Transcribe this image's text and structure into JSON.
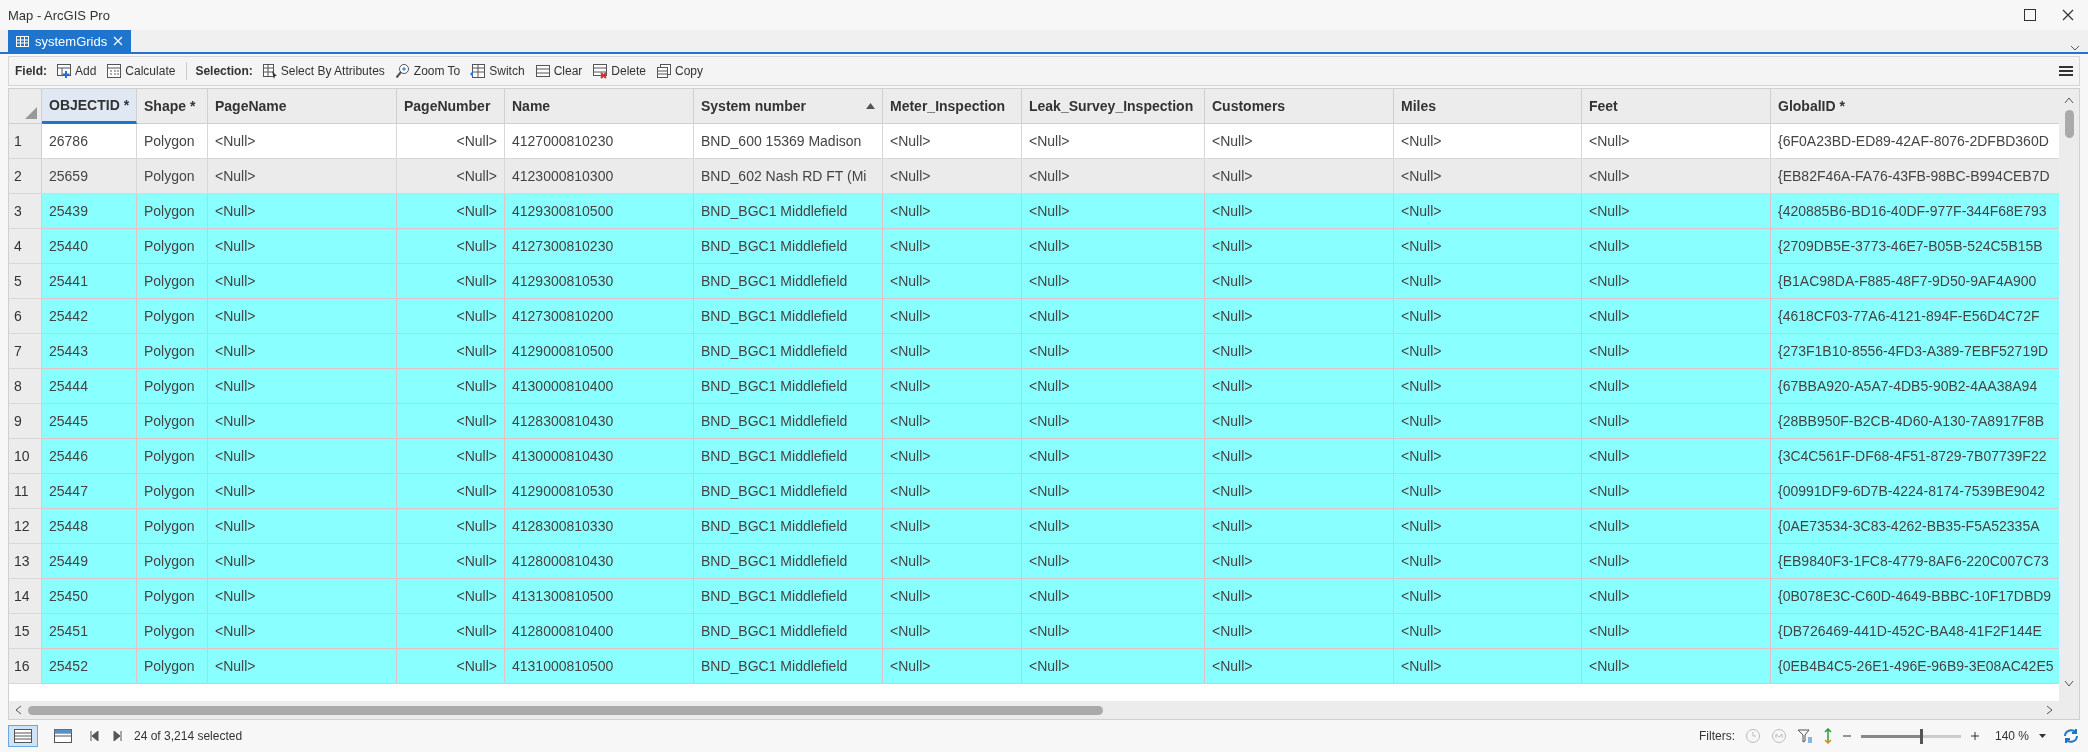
{
  "window": {
    "title": "Map - ArcGIS Pro"
  },
  "tabs": [
    {
      "label": "systemGrids",
      "selected": true
    }
  ],
  "toolbar": {
    "groups": [
      {
        "label": "Field:",
        "buttons": [
          {
            "label": "Add",
            "kind": "add"
          },
          {
            "label": "Calculate",
            "kind": "calculate"
          }
        ]
      },
      {
        "label": "Selection:",
        "buttons": [
          {
            "label": "Select By Attributes",
            "kind": "select"
          },
          {
            "label": "Zoom To",
            "kind": "zoom"
          },
          {
            "label": "Switch",
            "kind": "switch"
          },
          {
            "label": "Clear",
            "kind": "clear"
          },
          {
            "label": "Delete",
            "kind": "delete"
          },
          {
            "label": "Copy",
            "kind": "copy"
          }
        ]
      }
    ]
  },
  "table": {
    "columns": [
      {
        "label": "OBJECTID *",
        "kind": "text",
        "sorted": false,
        "focused": true
      },
      {
        "label": "Shape *",
        "kind": "text",
        "sorted": false,
        "focused": false
      },
      {
        "label": "PageName",
        "kind": "text",
        "sorted": false,
        "focused": false
      },
      {
        "label": "PageNumber",
        "kind": "numeric",
        "sorted": false,
        "focused": false
      },
      {
        "label": "Name",
        "kind": "text",
        "sorted": false,
        "focused": false
      },
      {
        "label": "System number",
        "kind": "text",
        "sorted": true,
        "focused": false
      },
      {
        "label": "Meter_Inspection",
        "kind": "text",
        "sorted": false,
        "focused": false
      },
      {
        "label": "Leak_Survey_Inspection",
        "kind": "text",
        "sorted": false,
        "focused": false
      },
      {
        "label": "Customers",
        "kind": "text",
        "sorted": false,
        "focused": false
      },
      {
        "label": "Miles",
        "kind": "text",
        "sorted": false,
        "focused": false
      },
      {
        "label": "Feet",
        "kind": "text",
        "sorted": false,
        "focused": false
      },
      {
        "label": "GlobalID *",
        "kind": "text",
        "sorted": false,
        "focused": false
      }
    ],
    "rows": [
      {
        "number": "1",
        "selected": false,
        "cells": [
          "26786",
          "Polygon",
          "<Null>",
          "<Null>",
          "4127000810230",
          "BND_600 15369 Madison",
          "<Null>",
          "<Null>",
          "<Null>",
          "<Null>",
          "<Null>",
          "{6F0A23BD-ED89-42AF-8076-2DFBD360D"
        ]
      },
      {
        "number": "2",
        "selected": false,
        "cells": [
          "25659",
          "Polygon",
          "<Null>",
          "<Null>",
          "4123000810300",
          "BND_602 Nash RD FT (Mi",
          "<Null>",
          "<Null>",
          "<Null>",
          "<Null>",
          "<Null>",
          "{EB82F46A-FA76-43FB-98BC-B994CEB7D"
        ]
      },
      {
        "number": "3",
        "selected": true,
        "cells": [
          "25439",
          "Polygon",
          "<Null>",
          "<Null>",
          "4129300810500",
          "BND_BGC1 Middlefield",
          "<Null>",
          "<Null>",
          "<Null>",
          "<Null>",
          "<Null>",
          "{420885B6-BD16-40DF-977F-344F68E793"
        ]
      },
      {
        "number": "4",
        "selected": true,
        "cells": [
          "25440",
          "Polygon",
          "<Null>",
          "<Null>",
          "4127300810230",
          "BND_BGC1 Middlefield",
          "<Null>",
          "<Null>",
          "<Null>",
          "<Null>",
          "<Null>",
          "{2709DB5E-3773-46E7-B05B-524C5B15B"
        ]
      },
      {
        "number": "5",
        "selected": true,
        "cells": [
          "25441",
          "Polygon",
          "<Null>",
          "<Null>",
          "4129300810530",
          "BND_BGC1 Middlefield",
          "<Null>",
          "<Null>",
          "<Null>",
          "<Null>",
          "<Null>",
          "{B1AC98DA-F885-48F7-9D50-9AF4A900"
        ]
      },
      {
        "number": "6",
        "selected": true,
        "cells": [
          "25442",
          "Polygon",
          "<Null>",
          "<Null>",
          "4127300810200",
          "BND_BGC1 Middlefield",
          "<Null>",
          "<Null>",
          "<Null>",
          "<Null>",
          "<Null>",
          "{4618CF03-77A6-4121-894F-E56D4C72F"
        ]
      },
      {
        "number": "7",
        "selected": true,
        "cells": [
          "25443",
          "Polygon",
          "<Null>",
          "<Null>",
          "4129000810500",
          "BND_BGC1 Middlefield",
          "<Null>",
          "<Null>",
          "<Null>",
          "<Null>",
          "<Null>",
          "{273F1B10-8556-4FD3-A389-7EBF52719D"
        ]
      },
      {
        "number": "8",
        "selected": true,
        "cells": [
          "25444",
          "Polygon",
          "<Null>",
          "<Null>",
          "4130000810400",
          "BND_BGC1 Middlefield",
          "<Null>",
          "<Null>",
          "<Null>",
          "<Null>",
          "<Null>",
          "{67BBA920-A5A7-4DB5-90B2-4AA38A94"
        ]
      },
      {
        "number": "9",
        "selected": true,
        "cells": [
          "25445",
          "Polygon",
          "<Null>",
          "<Null>",
          "4128300810430",
          "BND_BGC1 Middlefield",
          "<Null>",
          "<Null>",
          "<Null>",
          "<Null>",
          "<Null>",
          "{28BB950F-B2CB-4D60-A130-7A8917F8B"
        ]
      },
      {
        "number": "10",
        "selected": true,
        "cells": [
          "25446",
          "Polygon",
          "<Null>",
          "<Null>",
          "4130000810430",
          "BND_BGC1 Middlefield",
          "<Null>",
          "<Null>",
          "<Null>",
          "<Null>",
          "<Null>",
          "{3C4C561F-DF68-4F51-8729-7B07739F22"
        ]
      },
      {
        "number": "11",
        "selected": true,
        "cells": [
          "25447",
          "Polygon",
          "<Null>",
          "<Null>",
          "4129000810530",
          "BND_BGC1 Middlefield",
          "<Null>",
          "<Null>",
          "<Null>",
          "<Null>",
          "<Null>",
          "{00991DF9-6D7B-4224-8174-7539BE9042"
        ]
      },
      {
        "number": "12",
        "selected": true,
        "cells": [
          "25448",
          "Polygon",
          "<Null>",
          "<Null>",
          "4128300810330",
          "BND_BGC1 Middlefield",
          "<Null>",
          "<Null>",
          "<Null>",
          "<Null>",
          "<Null>",
          "{0AE73534-3C83-4262-BB35-F5A52335A"
        ]
      },
      {
        "number": "13",
        "selected": true,
        "cells": [
          "25449",
          "Polygon",
          "<Null>",
          "<Null>",
          "4128000810430",
          "BND_BGC1 Middlefield",
          "<Null>",
          "<Null>",
          "<Null>",
          "<Null>",
          "<Null>",
          "{EB9840F3-1FC8-4779-8AF6-220C007C73"
        ]
      },
      {
        "number": "14",
        "selected": true,
        "cells": [
          "25450",
          "Polygon",
          "<Null>",
          "<Null>",
          "4131300810500",
          "BND_BGC1 Middlefield",
          "<Null>",
          "<Null>",
          "<Null>",
          "<Null>",
          "<Null>",
          "{0B078E3C-C60D-4649-BBBC-10F17DBD9"
        ]
      },
      {
        "number": "15",
        "selected": true,
        "cells": [
          "25451",
          "Polygon",
          "<Null>",
          "<Null>",
          "4128000810400",
          "BND_BGC1 Middlefield",
          "<Null>",
          "<Null>",
          "<Null>",
          "<Null>",
          "<Null>",
          "{DB726469-441D-452C-BA48-41F2F144E"
        ]
      },
      {
        "number": "16",
        "selected": true,
        "cells": [
          "25452",
          "Polygon",
          "<Null>",
          "<Null>",
          "4131000810500",
          "BND_BGC1 Middlefield",
          "<Null>",
          "<Null>",
          "<Null>",
          "<Null>",
          "<Null>",
          "{0EB4B4C5-26E1-496E-96B9-3E08AC42E5"
        ]
      }
    ]
  },
  "status_bar": {
    "views": [
      {
        "kind": "table",
        "selected": true
      },
      {
        "kind": "fields",
        "selected": false
      }
    ],
    "selection": "24 of 3,214 selected",
    "filters_label": "Filters:",
    "zoom": {
      "level": 0.6,
      "value": "140 %"
    }
  }
}
